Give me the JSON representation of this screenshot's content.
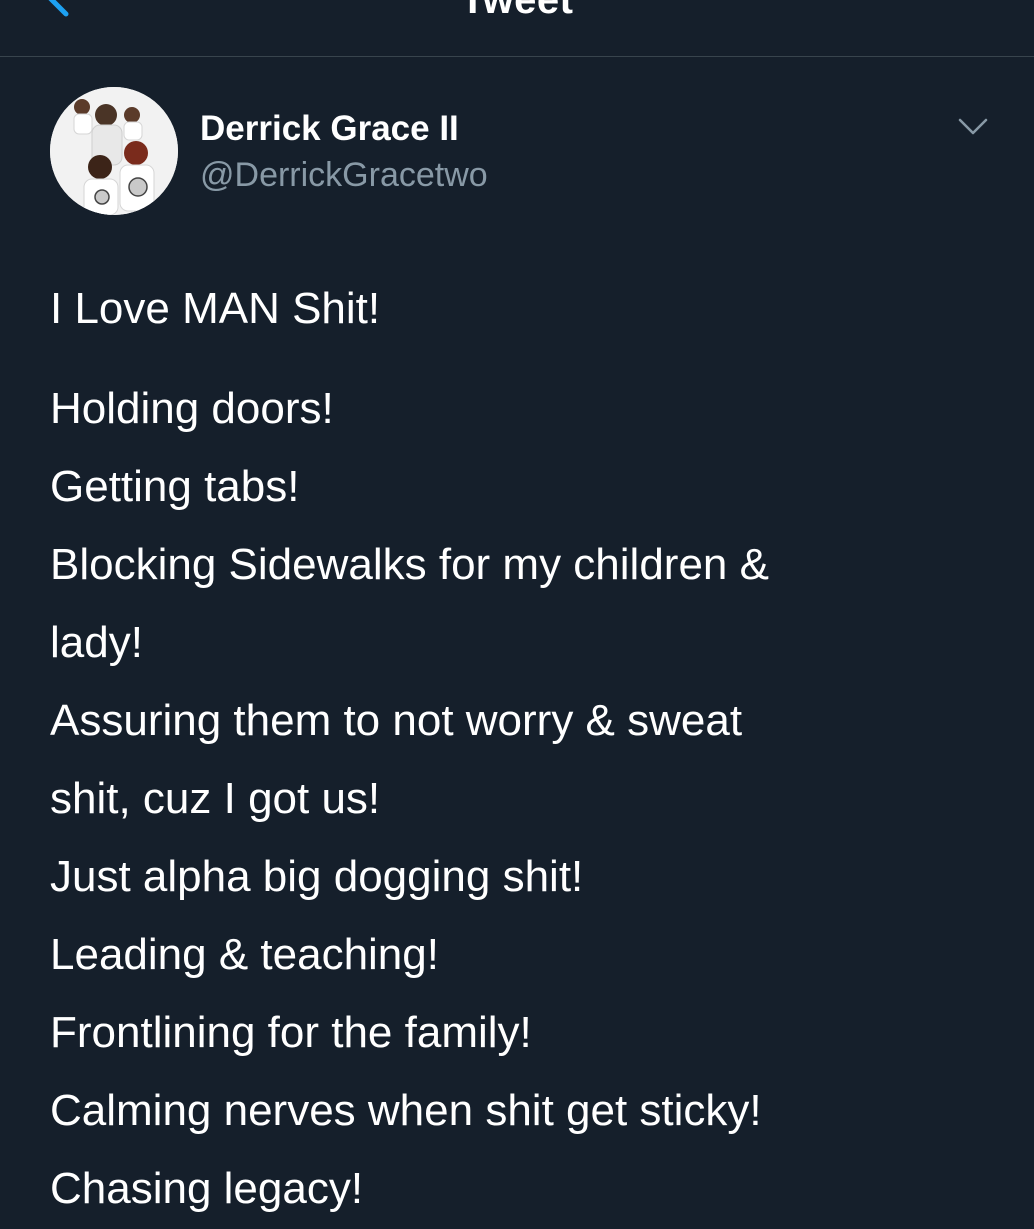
{
  "nav": {
    "title": "Tweet",
    "back_icon": "chevron-left-icon",
    "accent_color": "#1da1f2"
  },
  "author": {
    "display_name": "Derrick Grace II",
    "handle": "@DerrickGracetwo",
    "avatar_icon": "profile-photo",
    "more_icon": "chevron-down-icon"
  },
  "tweet": {
    "intro": "I Love MAN Shit!",
    "lines": [
      "Holding doors!",
      "Getting tabs!",
      "Blocking Sidewalks for my children &",
      "lady!",
      "Assuring them to not worry & sweat",
      "shit, cuz I got us!",
      "Just alpha big dogging shit!",
      "Leading & teaching!",
      "Frontlining for the family!",
      "Calming nerves when shit get sticky!",
      "Chasing legacy!"
    ]
  },
  "colors": {
    "background": "#151f2b",
    "text": "#ffffff",
    "secondary_text": "#8899a6",
    "divider": "#38444d"
  }
}
